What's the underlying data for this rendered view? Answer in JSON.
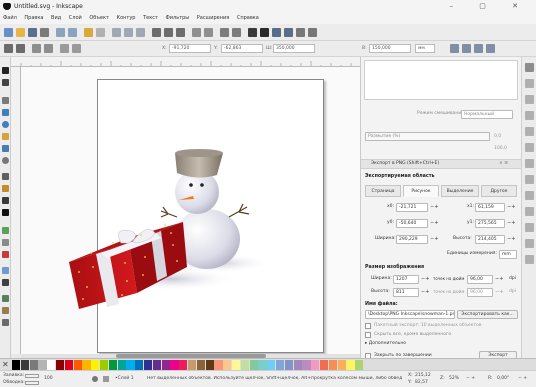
{
  "window": {
    "title": "Untitled.svg - Inkscape",
    "controls": "–  ▢  ✕"
  },
  "menu": {
    "items": [
      "Файл",
      "Правка",
      "Вид",
      "Слой",
      "Объект",
      "Контур",
      "Текст",
      "Фильтры",
      "Расширения",
      "Справка"
    ]
  },
  "controls_bar": {
    "x_label": "X:",
    "x_value": "-91,720",
    "y_label": "Y:",
    "y_value": "-62,863",
    "w_label": "Ш:",
    "w_value": "350,000",
    "h_label": "В:",
    "h_value": "150,000",
    "unit": "мм"
  },
  "dock": {
    "fill_label": "Режим смешивания:",
    "fill_value": "Нормальный",
    "blur_label": "Размытие (%)",
    "blur_value": "0,0",
    "opacity_value": "100,0",
    "panel_title": "Экспорт в PNG (Shift+Ctrl+E)",
    "export_area_label": "Экспортируемая область",
    "tabs": [
      "Страница",
      "Рисунок",
      "Выделение",
      "Другое"
    ],
    "x0_label": "x0:",
    "x0_value": "-21,721",
    "x1_label": "x1:",
    "x1_value": "61,159",
    "y0_label": "y0:",
    "y0_value": "-50,640",
    "y1_label": "y1:",
    "y1_value": "275,565",
    "width_label": "Ширина:",
    "width_value": "290,229",
    "height_label": "Высота:",
    "height_value": "214,405",
    "units_label": "Единицы измерения:",
    "units_value": "mm",
    "image_size_label": "Размер изображения",
    "img_width_label": "Ширина:",
    "img_width_value": "1207",
    "px_at_label": "точек на дюйм",
    "dpi_value": "96,00",
    "img_height_label": "Высота:",
    "img_height_value": "811",
    "dpi2_value": "96,00",
    "dpi_unit": "dpi",
    "filename_label": "Имя файла:",
    "filename_value": "\\Desktop\\PNG Inkscape\\snowman-1.png",
    "export_as_button": "Экспортировать как...",
    "batch_label": "Пакетный экспорт: 10 выделенных объектов",
    "hide_label": "Скрыть все, кроме выделенного",
    "advanced_label": "Дополнительно",
    "close_label": "Закрыть по завершении",
    "export_button": "Экспорт"
  },
  "status": {
    "fill_label": "Заливка:",
    "stroke_label": "Обводка:",
    "opacity_value": "100",
    "layer": "•Слой 1",
    "message": "Нет выделенных объектов. Используйте щелчок, Shift+щелчок, Alt+прокрутка колесом мыши, либо обведите",
    "x_label": "X:",
    "x_value": "215,12",
    "y_label": "Y:",
    "y_value": "82,57",
    "zoom_label": "Z:",
    "zoom_value": "52%",
    "rotation_label": "R:",
    "rotation_value": "0,00°"
  },
  "palette": [
    "#000000",
    "#3a3a3a",
    "#7a7a7a",
    "#b4b4b4",
    "#ffffff",
    "#8b0000",
    "#e0001b",
    "#ff5a00",
    "#ffb400",
    "#fff200",
    "#9ccc00",
    "#009a3c",
    "#00a596",
    "#00aeef",
    "#0072bc",
    "#2e3192",
    "#662d91",
    "#92278f",
    "#ec008c",
    "#ed1c5c",
    "#c69c6d",
    "#8c6239",
    "#603813",
    "#f7977a",
    "#fdc68a",
    "#fff799",
    "#c4df9b",
    "#82ca9d",
    "#7bcdc8",
    "#6ecff6",
    "#7ea7d8",
    "#8393ca",
    "#a187be",
    "#bd8cbf",
    "#f49ac1",
    "#f26c4f",
    "#f68e56",
    "#fbaf5d",
    "#fff467",
    "#acd372"
  ]
}
